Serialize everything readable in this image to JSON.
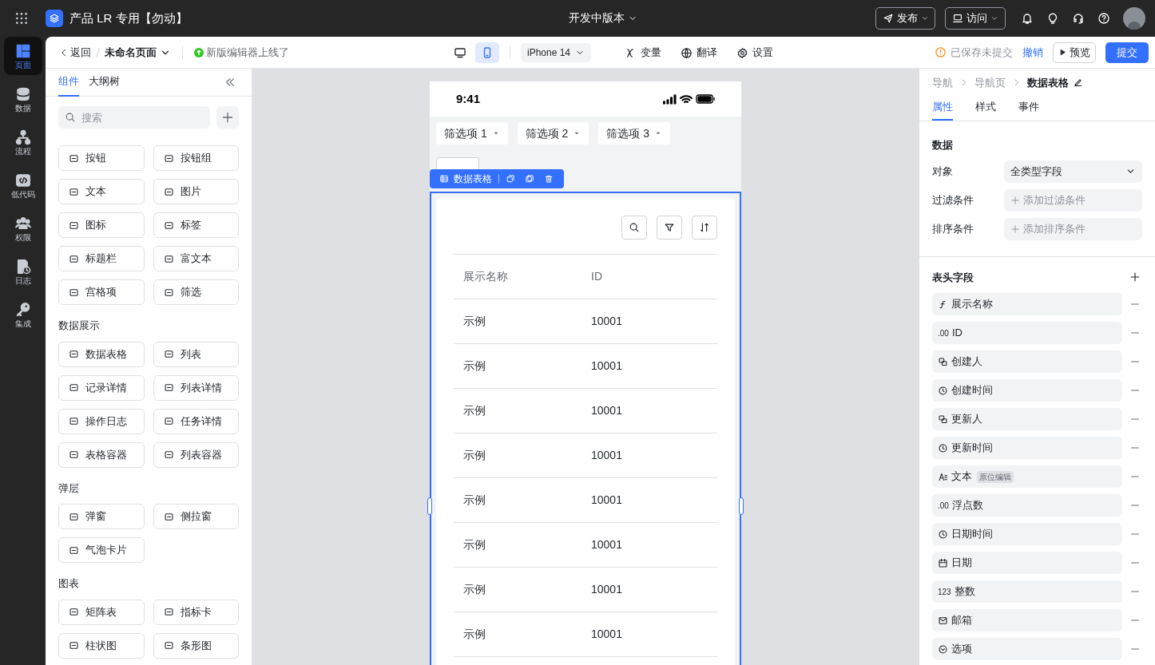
{
  "app": {
    "title": "产品 LR 专用【勿动】",
    "version": "开发中版本",
    "publish": "发布",
    "visit": "访问"
  },
  "rail": [
    {
      "kind": "page",
      "label": "页面",
      "selected": true
    },
    {
      "kind": "data",
      "label": "数据",
      "selected": false
    },
    {
      "kind": "flow",
      "label": "流程",
      "selected": false
    },
    {
      "kind": "code",
      "label": "低代码",
      "selected": false
    },
    {
      "kind": "users",
      "label": "权限",
      "selected": false
    },
    {
      "kind": "log",
      "label": "日志",
      "selected": false
    },
    {
      "kind": "key",
      "label": "集成",
      "selected": false
    }
  ],
  "toolbar": {
    "back": "返回",
    "page": "未命名页面",
    "notice": "新版编辑器上线了",
    "devices": [
      {
        "kind": "desktop",
        "selected": false
      },
      {
        "kind": "mobile",
        "selected": true
      }
    ],
    "device_model": "iPhone 14",
    "tools": [
      {
        "kind": "variable",
        "label": "变量"
      },
      {
        "kind": "translate",
        "label": "翻译"
      },
      {
        "kind": "settings",
        "label": "设置"
      }
    ],
    "save_status": "已保存未提交",
    "undo": "撤销",
    "preview": "预览",
    "submit": "提交"
  },
  "left_panel": {
    "tabs": [
      {
        "label": "组件",
        "selected": true
      },
      {
        "label": "大纲树",
        "selected": false
      }
    ],
    "search": {
      "placeholder": "搜索"
    },
    "groups": [
      {
        "items": [
          "按钮",
          "按钮组",
          "文本",
          "图片",
          "图标",
          "标签",
          "标题栏",
          "富文本",
          "宫格项",
          "筛选"
        ]
      },
      {
        "title": "数据展示",
        "items": [
          "数据表格",
          "列表",
          "记录详情",
          "列表详情",
          "操作日志",
          "任务详情",
          "表格容器",
          "列表容器"
        ]
      },
      {
        "title": "弹层",
        "items": [
          "弹窗",
          "侧拉窗",
          "气泡卡片"
        ]
      },
      {
        "title": "图表",
        "items": [
          "矩阵表",
          "指标卡",
          "柱状图",
          "条形图"
        ]
      }
    ]
  },
  "canvas": {
    "status_time": "9:41",
    "filters": [
      "筛选项 1",
      "筛选项 2",
      "筛选项 3"
    ],
    "selection": {
      "label": "数据表格"
    },
    "table": {
      "columns": [
        "展示名称",
        "ID"
      ],
      "rows": [
        [
          "示例",
          "10001"
        ],
        [
          "示例",
          "10001"
        ],
        [
          "示例",
          "10001"
        ],
        [
          "示例",
          "10001"
        ],
        [
          "示例",
          "10001"
        ],
        [
          "示例",
          "10001"
        ],
        [
          "示例",
          "10001"
        ],
        [
          "示例",
          "10001"
        ]
      ]
    }
  },
  "right_panel": {
    "breadcrumb": [
      "导航",
      "导航页",
      "数据表格"
    ],
    "tabs": [
      {
        "label": "属性",
        "selected": true
      },
      {
        "label": "样式",
        "selected": false
      },
      {
        "label": "事件",
        "selected": false
      }
    ],
    "data_section": {
      "title": "数据",
      "fields": [
        {
          "label": "对象",
          "kind": "select",
          "value": "全类型字段"
        },
        {
          "label": "过滤条件",
          "kind": "add",
          "value": "添加过滤条件"
        },
        {
          "label": "排序条件",
          "kind": "add",
          "value": "添加排序条件"
        }
      ]
    },
    "columns_section": {
      "title": "表头字段",
      "fields": [
        {
          "kind": "formula",
          "label": "展示名称"
        },
        {
          "kind": "glyph",
          "glyph": ".00",
          "label": "ID"
        },
        {
          "kind": "user",
          "label": "创建人"
        },
        {
          "kind": "time",
          "label": "创建时间"
        },
        {
          "kind": "user",
          "label": "更新人"
        },
        {
          "kind": "time",
          "label": "更新时间"
        },
        {
          "kind": "text",
          "label": "文本",
          "badge": "原位编辑"
        },
        {
          "kind": "glyph",
          "glyph": ".00",
          "label": "浮点数"
        },
        {
          "kind": "time",
          "label": "日期时间"
        },
        {
          "kind": "date",
          "label": "日期"
        },
        {
          "kind": "glyph",
          "glyph": "123",
          "label": "整数"
        },
        {
          "kind": "email",
          "label": "邮箱"
        },
        {
          "kind": "option",
          "label": "选项"
        }
      ]
    }
  }
}
